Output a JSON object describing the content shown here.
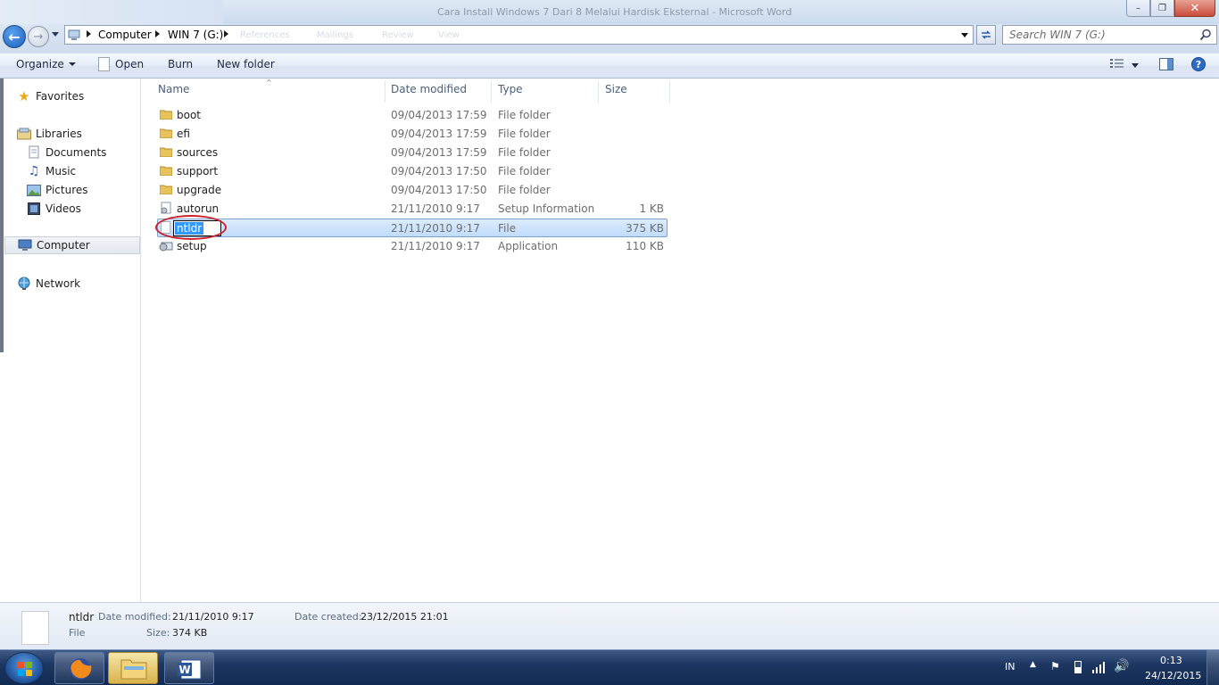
{
  "window": {
    "title": "Cara Install Windows 7 Dari 8 Melalui Hardisk Eksternal - Microsoft Word",
    "minimize_glyph": "–",
    "maximize_glyph": "❐",
    "close_glyph": "✕"
  },
  "nav": {
    "breadcrumb": [
      "Computer",
      "WIN 7 (G:)"
    ],
    "ghost_tabs": [
      "References",
      "Mailings",
      "Review",
      "View"
    ]
  },
  "search": {
    "placeholder": "Search WIN 7 (G:)"
  },
  "commands": {
    "organize": "Organize",
    "open": "Open",
    "burn": "Burn",
    "new_folder": "New folder"
  },
  "sidebar": {
    "favorites": "Favorites",
    "libraries": "Libraries",
    "documents": "Documents",
    "music": "Music",
    "pictures": "Pictures",
    "videos": "Videos",
    "computer": "Computer",
    "network": "Network"
  },
  "columns": {
    "name": "Name",
    "date": "Date modified",
    "type": "Type",
    "size": "Size"
  },
  "files": [
    {
      "name": "boot",
      "date": "09/04/2013 17:59",
      "type": "File folder",
      "size": "",
      "kind": "folder"
    },
    {
      "name": "efi",
      "date": "09/04/2013 17:59",
      "type": "File folder",
      "size": "",
      "kind": "folder"
    },
    {
      "name": "sources",
      "date": "09/04/2013 17:59",
      "type": "File folder",
      "size": "",
      "kind": "folder"
    },
    {
      "name": "support",
      "date": "09/04/2013 17:50",
      "type": "File folder",
      "size": "",
      "kind": "folder"
    },
    {
      "name": "upgrade",
      "date": "09/04/2013 17:50",
      "type": "File folder",
      "size": "",
      "kind": "folder"
    },
    {
      "name": "autorun",
      "date": "21/11/2010 9:17",
      "type": "Setup Information",
      "size": "1 KB",
      "kind": "inf"
    },
    {
      "name": "ntldr",
      "date": "21/11/2010 9:17",
      "type": "File",
      "size": "375 KB",
      "kind": "file"
    },
    {
      "name": "setup",
      "date": "21/11/2010 9:17",
      "type": "Application",
      "size": "110 KB",
      "kind": "app"
    }
  ],
  "rename_value": "ntldr",
  "details": {
    "name": "ntldr",
    "type": "File",
    "date_modified_label": "Date modified:",
    "date_modified": "21/11/2010 9:17",
    "size_label": "Size:",
    "size": "374 KB",
    "date_created_label": "Date created:",
    "date_created": "23/12/2015 21:01"
  },
  "taskbar": {
    "language": "IN",
    "time": "0:13",
    "date": "24/12/2015"
  },
  "colors": {
    "annotation_circle": "#d0202a",
    "selection": "#3399ff"
  }
}
